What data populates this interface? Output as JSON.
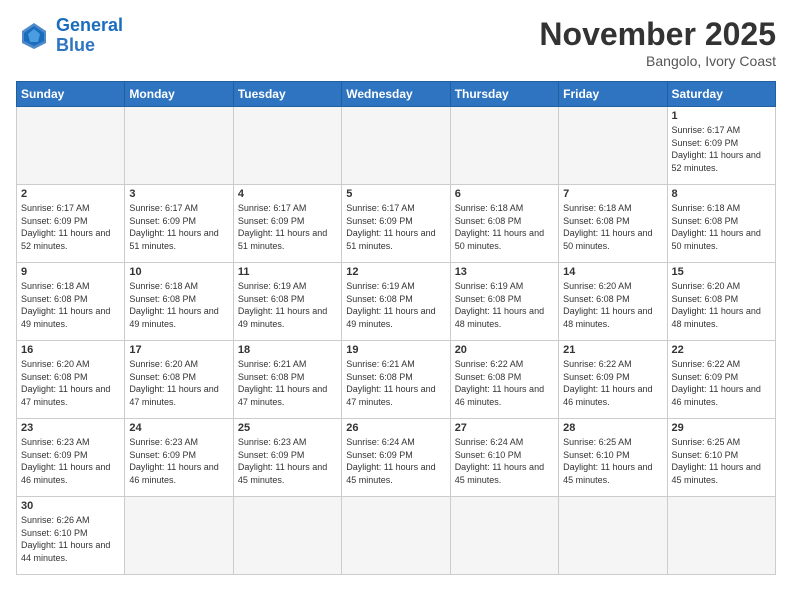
{
  "header": {
    "logo_general": "General",
    "logo_blue": "Blue",
    "month_title": "November 2025",
    "location": "Bangolo, Ivory Coast"
  },
  "weekdays": [
    "Sunday",
    "Monday",
    "Tuesday",
    "Wednesday",
    "Thursday",
    "Friday",
    "Saturday"
  ],
  "days": {
    "1": {
      "sunrise": "6:17 AM",
      "sunset": "6:09 PM",
      "daylight": "11 hours and 52 minutes."
    },
    "2": {
      "sunrise": "6:17 AM",
      "sunset": "6:09 PM",
      "daylight": "11 hours and 52 minutes."
    },
    "3": {
      "sunrise": "6:17 AM",
      "sunset": "6:09 PM",
      "daylight": "11 hours and 51 minutes."
    },
    "4": {
      "sunrise": "6:17 AM",
      "sunset": "6:09 PM",
      "daylight": "11 hours and 51 minutes."
    },
    "5": {
      "sunrise": "6:17 AM",
      "sunset": "6:09 PM",
      "daylight": "11 hours and 51 minutes."
    },
    "6": {
      "sunrise": "6:18 AM",
      "sunset": "6:08 PM",
      "daylight": "11 hours and 50 minutes."
    },
    "7": {
      "sunrise": "6:18 AM",
      "sunset": "6:08 PM",
      "daylight": "11 hours and 50 minutes."
    },
    "8": {
      "sunrise": "6:18 AM",
      "sunset": "6:08 PM",
      "daylight": "11 hours and 50 minutes."
    },
    "9": {
      "sunrise": "6:18 AM",
      "sunset": "6:08 PM",
      "daylight": "11 hours and 49 minutes."
    },
    "10": {
      "sunrise": "6:18 AM",
      "sunset": "6:08 PM",
      "daylight": "11 hours and 49 minutes."
    },
    "11": {
      "sunrise": "6:19 AM",
      "sunset": "6:08 PM",
      "daylight": "11 hours and 49 minutes."
    },
    "12": {
      "sunrise": "6:19 AM",
      "sunset": "6:08 PM",
      "daylight": "11 hours and 49 minutes."
    },
    "13": {
      "sunrise": "6:19 AM",
      "sunset": "6:08 PM",
      "daylight": "11 hours and 48 minutes."
    },
    "14": {
      "sunrise": "6:20 AM",
      "sunset": "6:08 PM",
      "daylight": "11 hours and 48 minutes."
    },
    "15": {
      "sunrise": "6:20 AM",
      "sunset": "6:08 PM",
      "daylight": "11 hours and 48 minutes."
    },
    "16": {
      "sunrise": "6:20 AM",
      "sunset": "6:08 PM",
      "daylight": "11 hours and 47 minutes."
    },
    "17": {
      "sunrise": "6:20 AM",
      "sunset": "6:08 PM",
      "daylight": "11 hours and 47 minutes."
    },
    "18": {
      "sunrise": "6:21 AM",
      "sunset": "6:08 PM",
      "daylight": "11 hours and 47 minutes."
    },
    "19": {
      "sunrise": "6:21 AM",
      "sunset": "6:08 PM",
      "daylight": "11 hours and 47 minutes."
    },
    "20": {
      "sunrise": "6:22 AM",
      "sunset": "6:08 PM",
      "daylight": "11 hours and 46 minutes."
    },
    "21": {
      "sunrise": "6:22 AM",
      "sunset": "6:09 PM",
      "daylight": "11 hours and 46 minutes."
    },
    "22": {
      "sunrise": "6:22 AM",
      "sunset": "6:09 PM",
      "daylight": "11 hours and 46 minutes."
    },
    "23": {
      "sunrise": "6:23 AM",
      "sunset": "6:09 PM",
      "daylight": "11 hours and 46 minutes."
    },
    "24": {
      "sunrise": "6:23 AM",
      "sunset": "6:09 PM",
      "daylight": "11 hours and 46 minutes."
    },
    "25": {
      "sunrise": "6:23 AM",
      "sunset": "6:09 PM",
      "daylight": "11 hours and 45 minutes."
    },
    "26": {
      "sunrise": "6:24 AM",
      "sunset": "6:09 PM",
      "daylight": "11 hours and 45 minutes."
    },
    "27": {
      "sunrise": "6:24 AM",
      "sunset": "6:10 PM",
      "daylight": "11 hours and 45 minutes."
    },
    "28": {
      "sunrise": "6:25 AM",
      "sunset": "6:10 PM",
      "daylight": "11 hours and 45 minutes."
    },
    "29": {
      "sunrise": "6:25 AM",
      "sunset": "6:10 PM",
      "daylight": "11 hours and 45 minutes."
    },
    "30": {
      "sunrise": "6:26 AM",
      "sunset": "6:10 PM",
      "daylight": "11 hours and 44 minutes."
    }
  }
}
